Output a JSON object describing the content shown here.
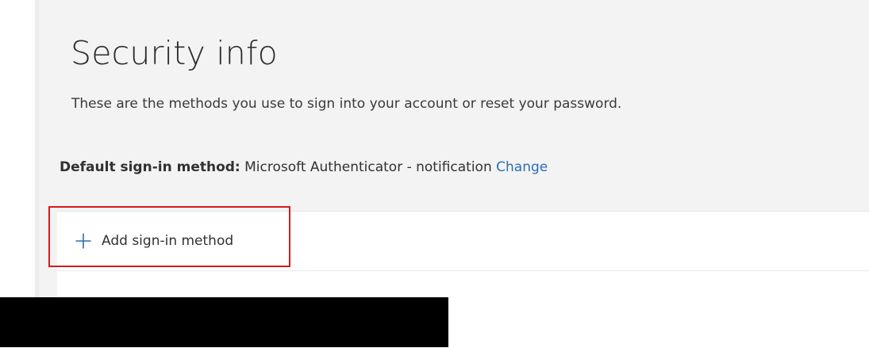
{
  "page": {
    "title": "Security info",
    "description": "These are the methods you use to sign into your account or reset your password."
  },
  "default_method": {
    "label": "Default sign-in method:",
    "value": "Microsoft Authenticator - notification",
    "change_link": "Change"
  },
  "methods": {
    "add_button_label": "Add sign-in method",
    "add_button_icon": "plus-icon"
  },
  "colors": {
    "link": "#2a6fb6",
    "accent_plus": "#2b6bb4",
    "highlight": "#d41c1c",
    "background": "#f3f3f3"
  }
}
